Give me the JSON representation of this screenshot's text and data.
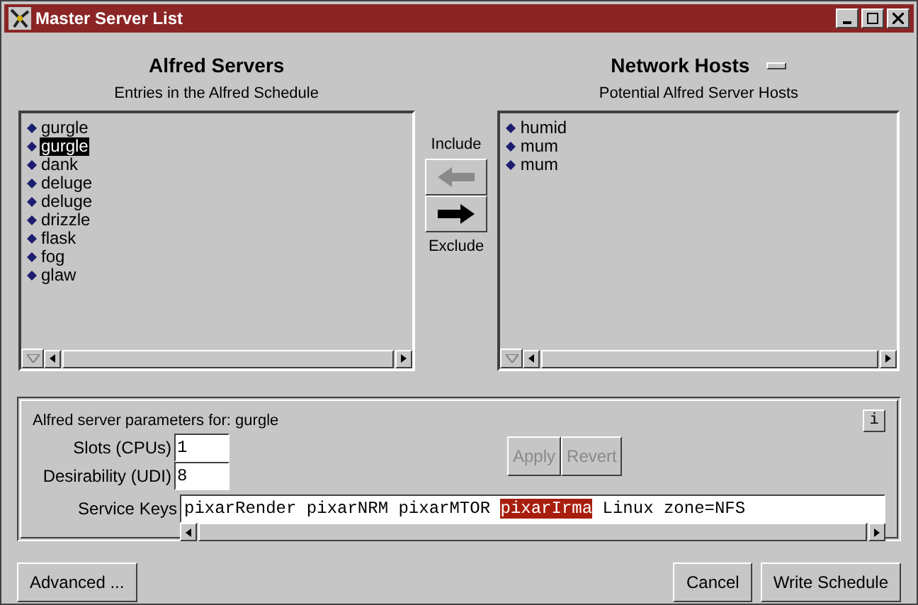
{
  "window": {
    "title": "Master Server List"
  },
  "left": {
    "title": "Alfred Servers",
    "subtitle": "Entries in the Alfred Schedule",
    "items": [
      {
        "label": "gurgle",
        "selected": false
      },
      {
        "label": "gurgle",
        "selected": true
      },
      {
        "label": "dank",
        "selected": false
      },
      {
        "label": "deluge",
        "selected": false
      },
      {
        "label": "deluge",
        "selected": false
      },
      {
        "label": "drizzle",
        "selected": false
      },
      {
        "label": "flask",
        "selected": false
      },
      {
        "label": "fog",
        "selected": false
      },
      {
        "label": "glaw",
        "selected": false
      }
    ]
  },
  "transfer": {
    "include_label": "Include",
    "include_disabled": true,
    "exclude_label": "Exclude",
    "exclude_disabled": false
  },
  "right": {
    "title": "Network Hosts",
    "subtitle": "Potential Alfred Server Hosts",
    "items": [
      {
        "label": "humid",
        "selected": false
      },
      {
        "label": "mum",
        "selected": false
      },
      {
        "label": "mum",
        "selected": false
      }
    ]
  },
  "params": {
    "heading": "Alfred server parameters for: gurgle",
    "info_button": "i",
    "slots": {
      "label": "Slots  (CPUs)",
      "value": "1"
    },
    "desirability": {
      "label": "Desirability (UDI)",
      "value": "8"
    },
    "apply": {
      "label": "Apply",
      "disabled": true
    },
    "revert": {
      "label": "Revert",
      "disabled": true
    },
    "service_keys": {
      "label": "Service Keys",
      "parts": [
        {
          "text": "pixarRender pixarNRM pixarMTOR ",
          "selected": false
        },
        {
          "text": "pixarIrma",
          "selected": true
        },
        {
          "text": " Linux zone=NFS",
          "selected": false
        }
      ]
    }
  },
  "buttons": [
    {
      "label": "Advanced ..."
    },
    {
      "label": "Cancel"
    },
    {
      "label": "Write Schedule"
    }
  ]
}
